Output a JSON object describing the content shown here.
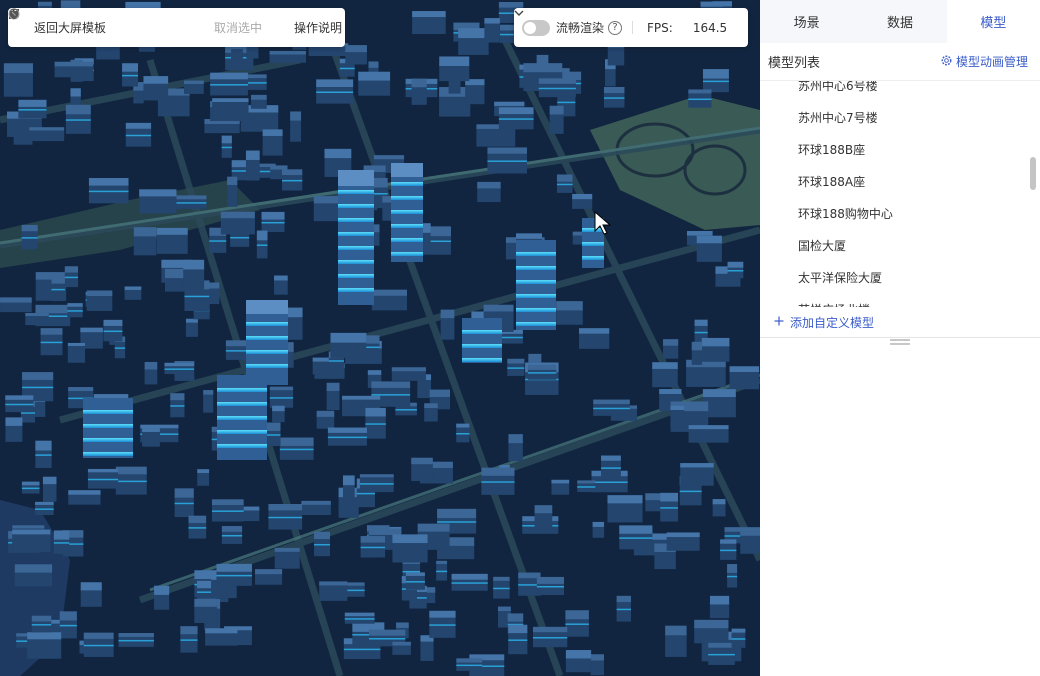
{
  "toolbar_left": {
    "back_label": "返回大屏模板",
    "cancel_select_label": "取消选中",
    "help_label": "操作说明"
  },
  "toolbar_right": {
    "smooth_render_label": "流畅渲染",
    "fps_label": "FPS:",
    "fps_value": "164.5"
  },
  "tabs": [
    {
      "label": "场景",
      "active": false
    },
    {
      "label": "数据",
      "active": false
    },
    {
      "label": "模型",
      "active": true
    }
  ],
  "model_list": {
    "title": "模型列表",
    "anim_manage_label": "模型动画管理",
    "items": [
      "苏州中心6号楼",
      "苏州中心7号楼",
      "环球188B座",
      "环球188A座",
      "环球188购物中心",
      "国检大厦",
      "太平洋保险大厦",
      "苏悦广场北楼"
    ],
    "add_label": "添加自定义模型"
  },
  "colors": {
    "accent": "#3b5cc9",
    "scene_bg": "#0f1f36",
    "building_glow": "#28c8ff"
  }
}
